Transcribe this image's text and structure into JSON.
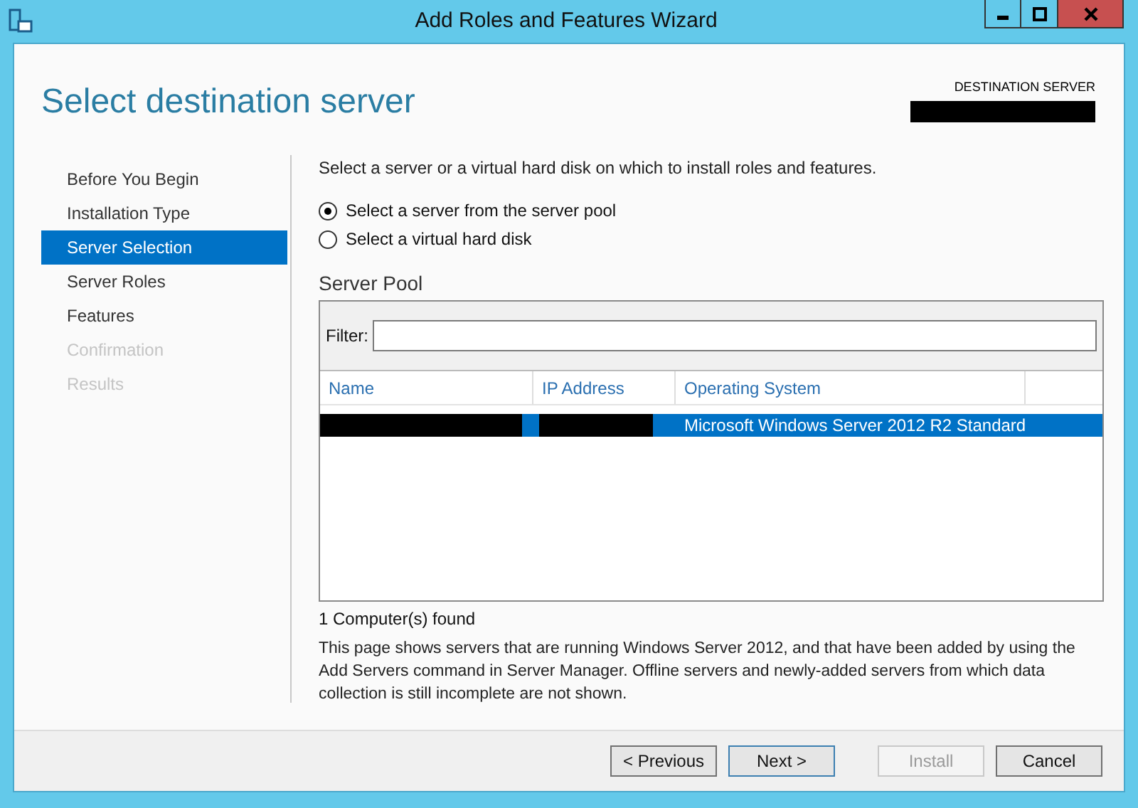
{
  "window": {
    "title": "Add Roles and Features Wizard"
  },
  "page_title": "Select destination server",
  "destination": {
    "label": "DESTINATION SERVER",
    "redacted": true
  },
  "steps": [
    {
      "label": "Before You Begin",
      "selected": false,
      "disabled": false
    },
    {
      "label": "Installation Type",
      "selected": false,
      "disabled": false
    },
    {
      "label": "Server Selection",
      "selected": true,
      "disabled": false
    },
    {
      "label": "Server Roles",
      "selected": false,
      "disabled": false
    },
    {
      "label": "Features",
      "selected": false,
      "disabled": false
    },
    {
      "label": "Confirmation",
      "selected": false,
      "disabled": true
    },
    {
      "label": "Results",
      "selected": false,
      "disabled": true
    }
  ],
  "intro": "Select a server or a virtual hard disk on which to install roles and features.",
  "options": [
    {
      "label": "Select a server from the server pool",
      "selected": true
    },
    {
      "label": "Select a virtual hard disk",
      "selected": false
    }
  ],
  "server_pool": {
    "title": "Server Pool",
    "filter_label": "Filter:",
    "columns": [
      "Name",
      "IP Address",
      "Operating System"
    ],
    "rows": [
      {
        "selected": true,
        "cells": [
          {
            "redacted": true
          },
          {
            "redacted": true
          },
          {
            "text": "Microsoft Windows Server 2012 R2 Standard"
          }
        ]
      }
    ]
  },
  "found": "1 Computer(s) found",
  "note": "This page shows servers that are running Windows Server 2012, and that have been added by using the Add Servers command in Server Manager. Offline servers and newly-added servers from which data collection is still incomplete are not shown.",
  "buttons": [
    {
      "label": "< Previous",
      "disabled": false,
      "focused": false
    },
    {
      "label": "Next >",
      "disabled": false,
      "focused": true
    },
    {
      "label": "Install",
      "disabled": true,
      "focused": false
    },
    {
      "label": "Cancel",
      "disabled": false,
      "focused": false
    }
  ]
}
